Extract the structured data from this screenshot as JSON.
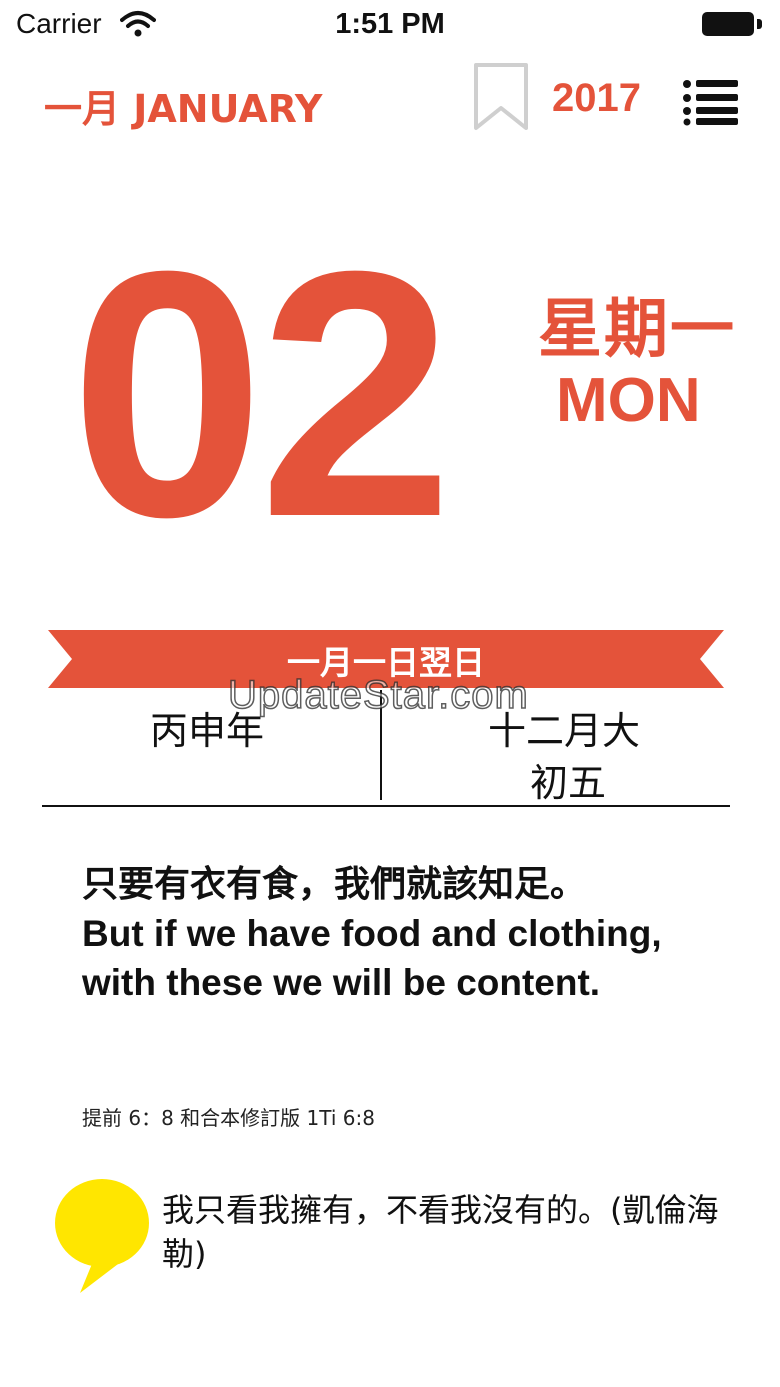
{
  "status_bar": {
    "carrier": "Carrier",
    "time": "1:51 PM"
  },
  "header": {
    "month": "一月 JANUARY",
    "year": "2017"
  },
  "day": {
    "number": "02",
    "weekday_zh": "星期一",
    "weekday_en": "MON"
  },
  "ribbon": {
    "text": "一月一日翌日"
  },
  "lunar": {
    "year": "丙申年",
    "month": "十二月大",
    "day": "初五"
  },
  "watermark": "UpdateStar.com",
  "verse": {
    "zh": "只要有衣有食，我們就該知足。",
    "en": "But if we have food and clothing, with these we will be content.",
    "reference": "提前 6：8 和合本修訂版 1Ti 6:8"
  },
  "quote": {
    "text": "我只看我擁有，不看我沒有的。(凱倫海勒)"
  },
  "colors": {
    "accent": "#e4533a",
    "bubble": "#ffe600",
    "text": "#111111"
  }
}
